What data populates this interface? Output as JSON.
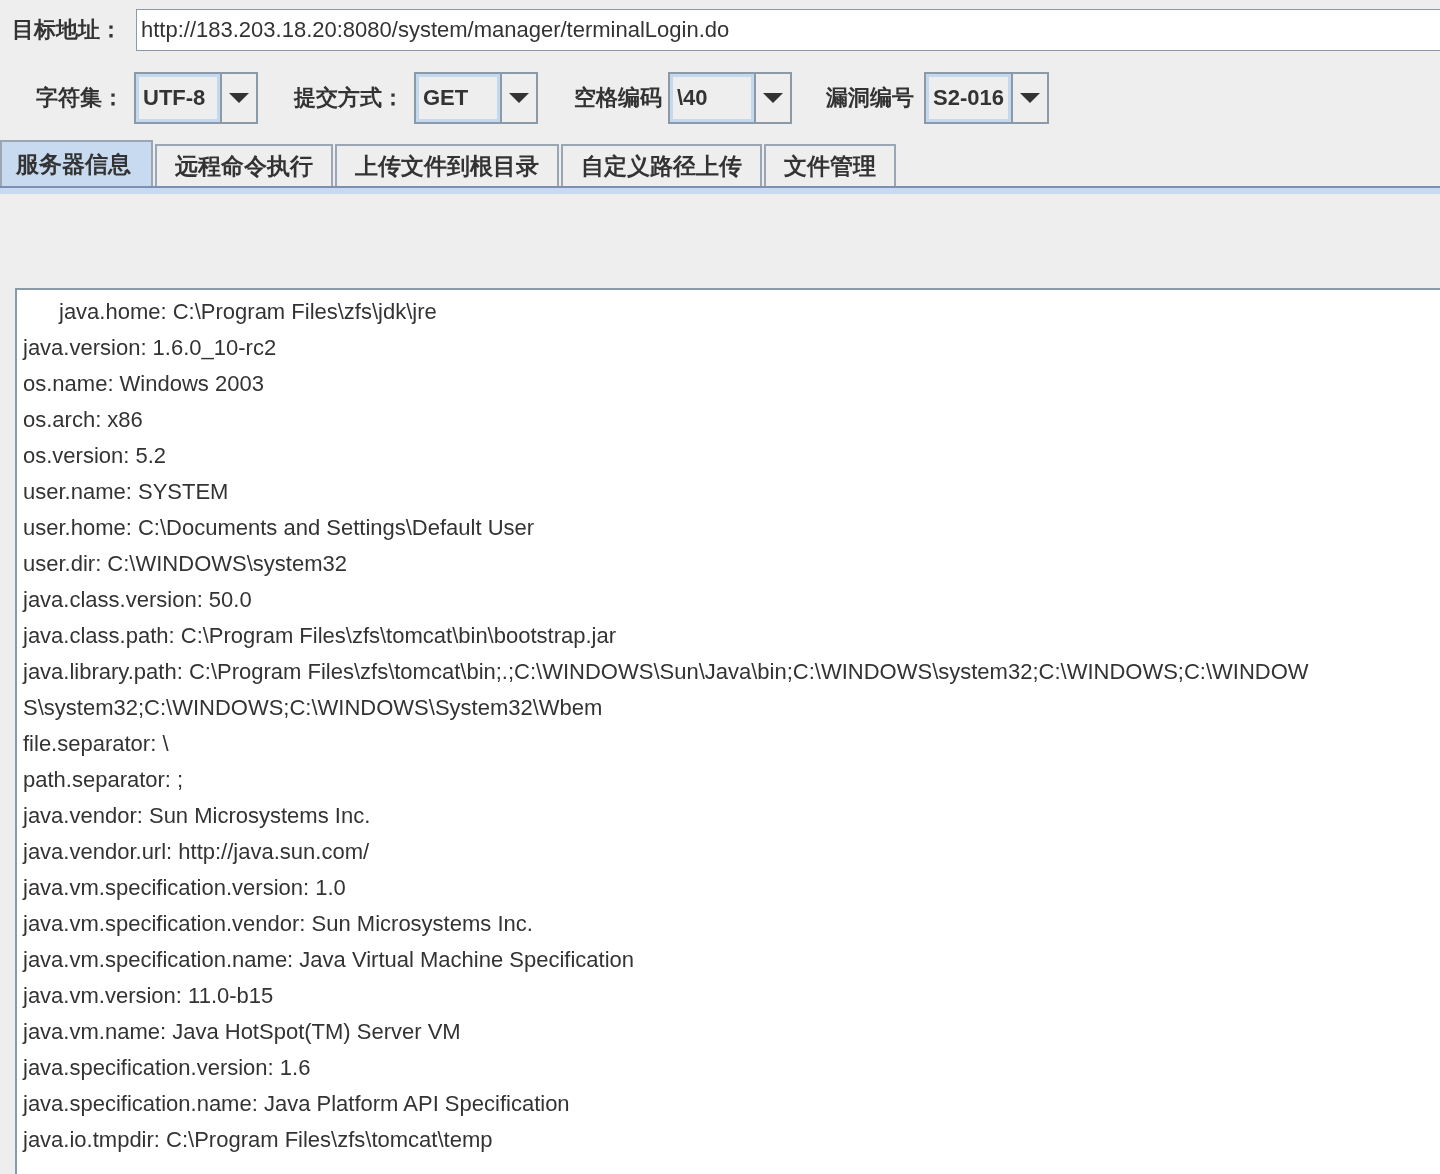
{
  "target": {
    "label": "目标地址：",
    "value": "http://183.203.18.20:8080/system/manager/terminalLogin.do"
  },
  "options": [
    {
      "label": "字符集：",
      "value": "UTF-8"
    },
    {
      "label": "提交方式：",
      "value": "GET"
    },
    {
      "label": "空格编码",
      "value": "\\40"
    },
    {
      "label": "漏洞编号",
      "value": "S2-016"
    }
  ],
  "tabs": [
    {
      "label": "服务器信息",
      "selected": true
    },
    {
      "label": "远程命令执行",
      "selected": false
    },
    {
      "label": "上传文件到根目录",
      "selected": false
    },
    {
      "label": "自定义路径上传",
      "selected": false
    },
    {
      "label": "文件管理",
      "selected": false
    }
  ],
  "output_lines": [
    "java.home: C:\\Program Files\\zfs\\jdk\\jre",
    "java.version: 1.6.0_10-rc2",
    "os.name: Windows 2003",
    "os.arch: x86",
    "os.version: 5.2",
    "user.name: SYSTEM",
    "user.home: C:\\Documents and Settings\\Default User",
    "user.dir: C:\\WINDOWS\\system32",
    "java.class.version: 50.0",
    "java.class.path: C:\\Program Files\\zfs\\tomcat\\bin\\bootstrap.jar",
    "java.library.path: C:\\Program Files\\zfs\\tomcat\\bin;.;C:\\WINDOWS\\Sun\\Java\\bin;C:\\WINDOWS\\system32;C:\\WINDOWS;C:\\WINDOWS\\system32;C:\\WINDOWS;C:\\WINDOWS\\System32\\Wbem",
    "file.separator: \\",
    "path.separator: ;",
    "java.vendor: Sun Microsystems Inc.",
    "java.vendor.url: http://java.sun.com/",
    "java.vm.specification.version: 1.0",
    "java.vm.specification.vendor: Sun Microsystems Inc.",
    "java.vm.specification.name: Java Virtual Machine Specification",
    "java.vm.version: 11.0-b15",
    "java.vm.name: Java HotSpot(TM) Server VM",
    "java.specification.version: 1.6",
    "java.specification.name: Java Platform API Specification",
    "java.io.tmpdir: C:\\Program Files\\zfs\\tomcat\\temp"
  ]
}
